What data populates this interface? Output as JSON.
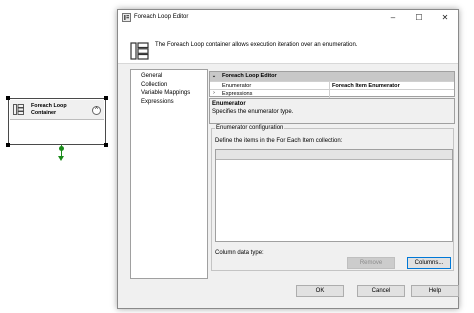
{
  "canvas": {
    "container_label": "Foreach Loop\nContainer",
    "collapse_glyph": "^"
  },
  "dialog": {
    "title": "Foreach Loop Editor",
    "window_buttons": {
      "minimize": "–",
      "maximize": "☐",
      "close": "✕"
    },
    "banner_text": "The Foreach Loop container allows execution iteration over an enumeration.",
    "nav_items": [
      "General",
      "Collection",
      "Variable Mappings",
      "Expressions"
    ],
    "grid": {
      "header_label": "Foreach Loop Editor",
      "rows": [
        {
          "name": "Enumerator",
          "value": "Foreach Item Enumerator"
        },
        {
          "name": "Expressions",
          "value": ""
        }
      ]
    },
    "description": {
      "title": "Enumerator",
      "text": "Specifies the enumerator type."
    },
    "enum_config": {
      "legend": "Enumerator configuration",
      "subtitle": "Define the items in the For Each Item collection:",
      "column_type_label": "Column data type:",
      "remove_label": "Remove",
      "columns_label": "Columns..."
    },
    "footer": {
      "ok": "OK",
      "cancel": "Cancel",
      "help": "Help"
    }
  }
}
